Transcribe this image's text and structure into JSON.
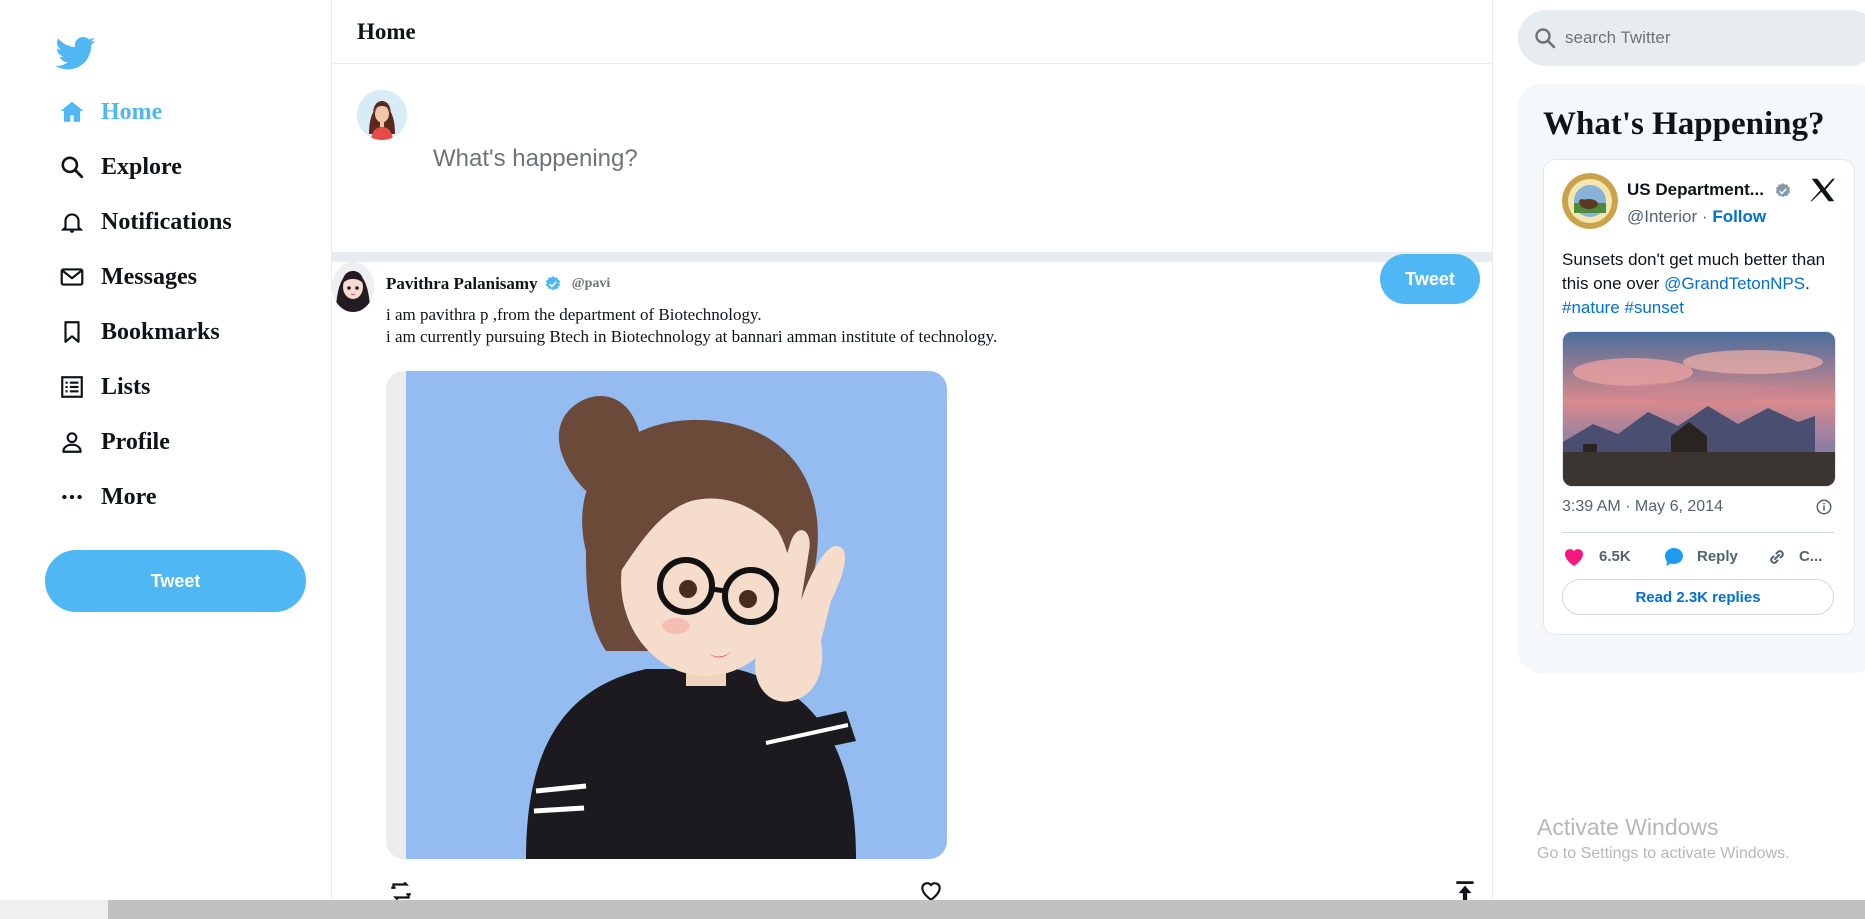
{
  "sidebar": {
    "nav": [
      {
        "label": "Home",
        "icon": "home-icon",
        "active": true
      },
      {
        "label": "Explore",
        "icon": "search-icon"
      },
      {
        "label": "Notifications",
        "icon": "bell-icon"
      },
      {
        "label": "Messages",
        "icon": "mail-icon"
      },
      {
        "label": "Bookmarks",
        "icon": "bookmark-icon"
      },
      {
        "label": "Lists",
        "icon": "list-icon"
      },
      {
        "label": "Profile",
        "icon": "person-icon"
      },
      {
        "label": "More",
        "icon": "more-icon"
      }
    ],
    "tweet_button": "Tweet"
  },
  "feed": {
    "title": "Home",
    "composer": {
      "placeholder": "What's happening?",
      "tweet_button": "Tweet"
    },
    "post": {
      "name": "Pavithra Palanisamy",
      "handle": "@pavi",
      "text_line1": "i am pavithra p ,from the department of Biotechnology.",
      "text_line2": "i am currently pursuing Btech in Biotechnology at bannari amman institute of technology."
    }
  },
  "search": {
    "placeholder": "search Twitter"
  },
  "widget": {
    "title": "What's Happening?",
    "embed": {
      "org_name": "US Department...",
      "org_handle": "@Interior",
      "follow": "Follow",
      "separator": "·",
      "body_1": "Sunsets don't get much better than this one over ",
      "body_link": "@GrandTetonNPS",
      "body_2": ".",
      "hashtags": "#nature #sunset",
      "time": "3:39 AM · May 6, 2014",
      "likes": "6.5K",
      "reply": "Reply",
      "copy": "C...",
      "read_replies": "Read 2.3K replies"
    }
  },
  "watermark": {
    "line1": "Activate Windows",
    "line2": "Go to Settings to activate Windows."
  },
  "colors": {
    "twitter_blue": "#50b7f5",
    "link_blue": "#006fd6",
    "like_pink": "#f91880",
    "border": "#e6ecf0"
  }
}
